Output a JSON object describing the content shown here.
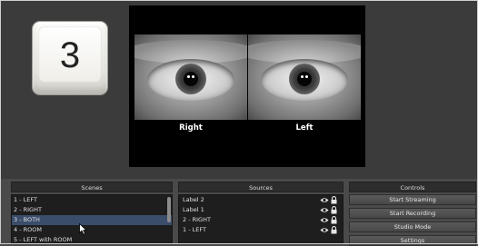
{
  "keycap": {
    "label": "3"
  },
  "preview": {
    "right_label": "Right",
    "left_label": "Left"
  },
  "scenes": {
    "header": "Scenes",
    "items": [
      "1 - LEFT",
      "2 - RIGHT",
      "3 - BOTH",
      "4 - ROOM",
      "5 - LEFT with ROOM"
    ],
    "selected_index": 2
  },
  "sources": {
    "header": "Sources",
    "items": [
      "Label 2",
      "Label 1",
      "2 - RIGHT",
      "1 - LEFT"
    ]
  },
  "controls": {
    "header": "Controls",
    "buttons": [
      "Start Streaming",
      "Start Recording",
      "Studio Mode",
      "Settings"
    ]
  },
  "colors": {
    "selection": "#3a4d6b",
    "panel_bg": "#1e1e1e",
    "window_bg": "#3b3b3b"
  }
}
